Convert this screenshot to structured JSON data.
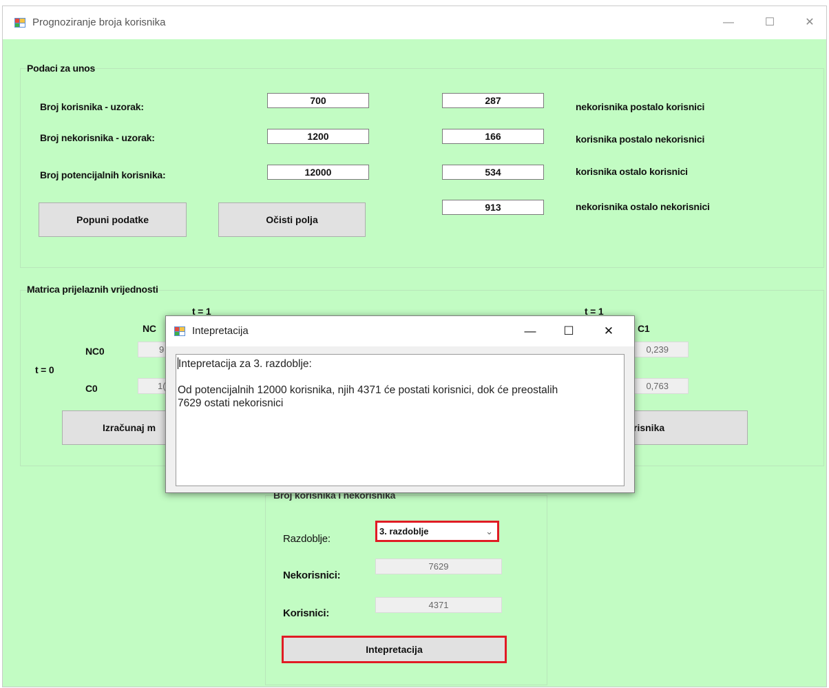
{
  "window": {
    "title": "Prognoziranje broja korisnika",
    "minimize": "—",
    "maximize": "☐",
    "close": "✕"
  },
  "input_group": {
    "title": "Podaci za unos",
    "users_label": "Broj korisnika - uzorak:",
    "users_value": "700",
    "nonusers_label": "Broj nekorisnika - uzorak:",
    "nonusers_value": "1200",
    "potential_label": "Broj potencijalnih korisnika:",
    "potential_value": "12000",
    "fill_button": "Popuni podatke",
    "clear_button": "Očisti polja",
    "transitions": [
      {
        "value": "287",
        "label": "nekorisnika postalo korisnici"
      },
      {
        "value": "166",
        "label": "korisnika postalo nekorisnici"
      },
      {
        "value": "534",
        "label": "korisnika ostalo korisnici"
      },
      {
        "value": "913",
        "label": "nekorisnika ostalo nekorisnici"
      }
    ]
  },
  "matrix_group": {
    "title": "Matrica prijelaznih vrijednosti",
    "t1_left": "t = 1",
    "t1_right": "t = 1",
    "col_nc_partial": "NC",
    "col_c1": "C1",
    "t0": "t = 0",
    "row_nc0": "NC0",
    "row_c0": "C0",
    "nc0_left_partial": "9",
    "c0_left_partial": "1(",
    "nc0_c1": "0,239",
    "c0_c1": "0,763",
    "calc_button_partial": "Izračunaj m",
    "users_button_partial": "risnika"
  },
  "result_group": {
    "title_partial": "Broj korisnika i nekorisnika",
    "period_label": "Razdoblje:",
    "period_value": "3. razdoblje",
    "nonusers_label": "Nekorisnici:",
    "nonusers_value": "7629",
    "users_label": "Korisnici:",
    "users_value": "4371",
    "interp_button": "Intepretacija"
  },
  "dialog": {
    "title": "Intepretacija",
    "minimize": "—",
    "maximize": "☐",
    "close": "✕",
    "line1": "Intepretacija za 3. razdoblje:",
    "line2": "Od potencijalnih 12000 korisnika, njih 4371 će postati korisnici, dok će preostalih",
    "line3": "7629 ostati nekorisnici"
  },
  "colors": {
    "background": "#c2fcc3",
    "highlight": "#e01b24"
  }
}
